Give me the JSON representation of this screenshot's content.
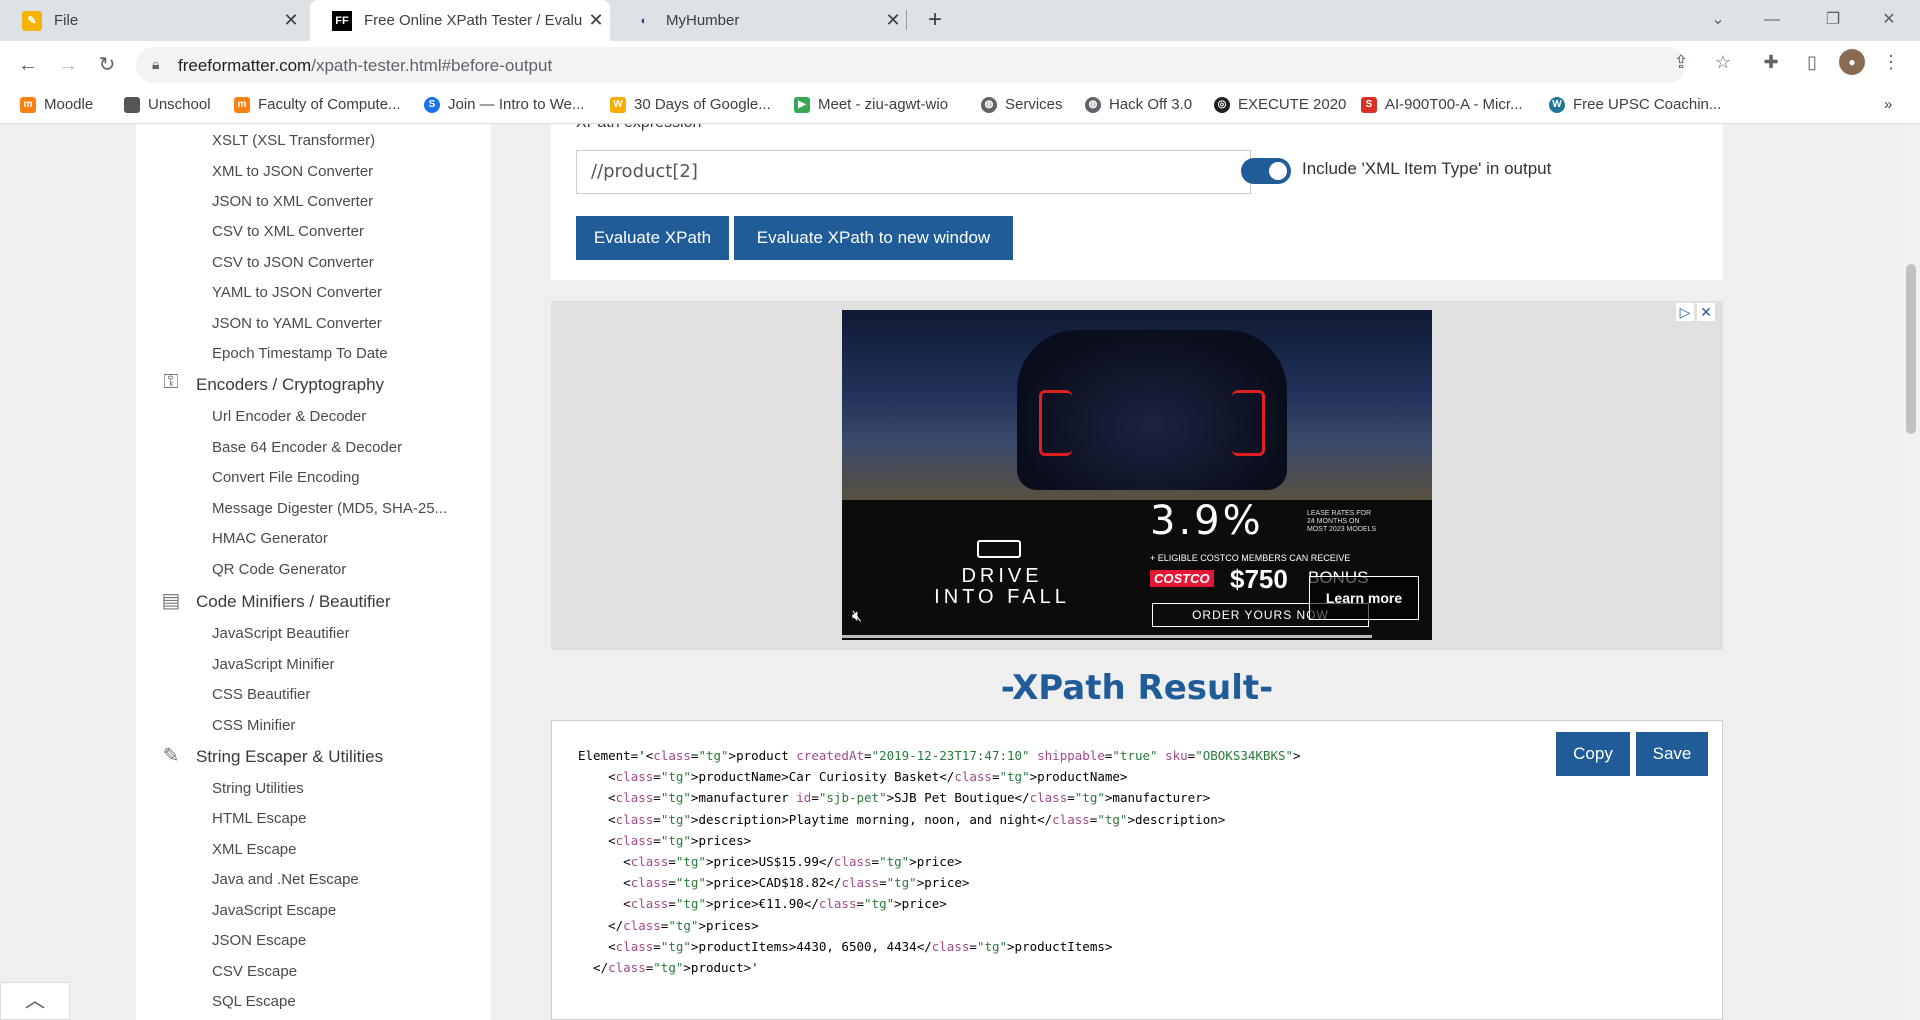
{
  "tabs": [
    {
      "title": "File",
      "icon": "pencil-doc-icon"
    },
    {
      "title": "Free Online XPath Tester / Evaluat",
      "icon": "ff-logo-icon"
    },
    {
      "title": "MyHumber",
      "icon": "humber-icon"
    }
  ],
  "toolbar": {
    "url_domain": "freeformatter.com",
    "url_path": "/xpath-tester.html#before-output"
  },
  "bookmarks": [
    {
      "label": "Moodle",
      "color": "#f98012"
    },
    {
      "label": "Unschool",
      "color": "#555555"
    },
    {
      "label": "Faculty of Compute...",
      "color": "#f98012"
    },
    {
      "label": "Join — Intro to We...",
      "color": "#1a73e8"
    },
    {
      "label": "30 Days of Google...",
      "color": "#f9ab00"
    },
    {
      "label": "Meet - ziu-agwt-wio",
      "color": "#34a853"
    },
    {
      "label": "Services",
      "color": "#5f6368"
    },
    {
      "label": "Hack Off 3.0",
      "color": "#5f6368"
    },
    {
      "label": "EXECUTE 2020",
      "color": "#202124"
    },
    {
      "label": "AI-900T00-A - Micr...",
      "color": "#d93025"
    },
    {
      "label": "Free UPSC Coachin...",
      "color": "#21759b"
    }
  ],
  "sidebar": {
    "items_group1": [
      "XSLT (XSL Transformer)",
      "XML to JSON Converter",
      "JSON to XML Converter",
      "CSV to XML Converter",
      "CSV to JSON Converter",
      "YAML to JSON Converter",
      "JSON to YAML Converter",
      "Epoch Timestamp To Date"
    ],
    "cat_encoders": "Encoders / Cryptography",
    "items_group2": [
      "Url Encoder & Decoder",
      "Base 64 Encoder & Decoder",
      "Convert File Encoding",
      "Message Digester (MD5, SHA-25...",
      "HMAC Generator",
      "QR Code Generator"
    ],
    "cat_minifiers": "Code Minifiers / Beautifier",
    "items_group3": [
      "JavaScript Beautifier",
      "JavaScript Minifier",
      "CSS Beautifier",
      "CSS Minifier"
    ],
    "cat_escapers": "String Escaper & Utilities",
    "items_group4": [
      "String Utilities",
      "HTML Escape",
      "XML Escape",
      "Java and .Net Escape",
      "JavaScript Escape",
      "JSON Escape",
      "CSV Escape",
      "SQL Escape"
    ]
  },
  "form": {
    "label": "XPath expression",
    "xpath_value": "//product[2]",
    "toggle_label": "Include 'XML Item Type' in output",
    "toggle_on": true,
    "evaluate_button": "Evaluate XPath",
    "evaluate_new_window_button": "Evaluate XPath to new window"
  },
  "ad": {
    "rate": "3.9%",
    "fine_print": "LEASE RATES FOR 24 MONTHS ON MOST 2023 MODELS",
    "eligible": "+ ELIGIBLE COSTCO MEMBERS CAN RECEIVE",
    "costco": "COSTCO",
    "bonus_amount": "$750",
    "bonus_word": "BONUS",
    "tagline_1": "DRIVE",
    "tagline_2": "INTO FALL",
    "order": "ORDER YOURS NOW",
    "learn_more": "Learn more"
  },
  "result": {
    "title": "-XPath Result-",
    "copy_button": "Copy",
    "save_button": "Save",
    "lines": [
      "Element='<product createdAt=\"2019-12-23T17:47:10\" shippable=\"true\" sku=\"OBOKS34KBKS\">",
      "    <productName>Car Curiosity Basket</productName>",
      "    <manufacturer id=\"sjb-pet\">SJB Pet Boutique</manufacturer>",
      "    <description>Playtime morning, noon, and night</description>",
      "    <prices>",
      "      <price>US$15.99</price>",
      "      <price>CAD$18.82</price>",
      "      <price>€11.90</price>",
      "    </prices>",
      "    <productItems>4430, 6500, 4434</productItems>",
      "  </product>'"
    ]
  },
  "colors": {
    "brand": "#1f5c98"
  }
}
